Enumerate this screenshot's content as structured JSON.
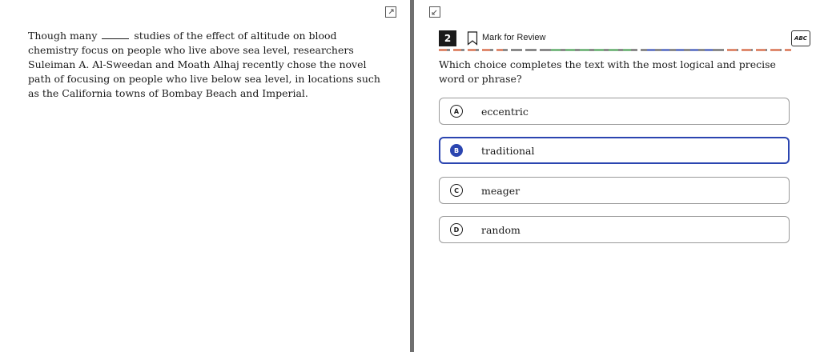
{
  "passage": {
    "before_blank": "Though many",
    "after_blank": "studies of the effect of altitude on blood chemistry focus on people who live above sea level, researchers Suleiman A. Al-Sweedan and Moath Alhaj recently chose the novel path of focusing on people who live below sea level, in locations such as the California towns of Bombay Beach and Imperial."
  },
  "question": {
    "number": "2",
    "mark_label": "Mark for Review",
    "abc_label": "ABC",
    "prompt": "Which choice completes the text with the most logical and precise word or phrase?",
    "choices": [
      {
        "letter": "A",
        "text": "eccentric"
      },
      {
        "letter": "B",
        "text": "traditional"
      },
      {
        "letter": "C",
        "text": "meager"
      },
      {
        "letter": "D",
        "text": "random"
      }
    ],
    "selected": "B"
  },
  "colors": {
    "selected_accent": "#2b45b0",
    "divider": "#6f6f6f",
    "dash_palette": [
      "#d0542c",
      "#3e9a4a",
      "#2b45b0",
      "#555555"
    ]
  }
}
